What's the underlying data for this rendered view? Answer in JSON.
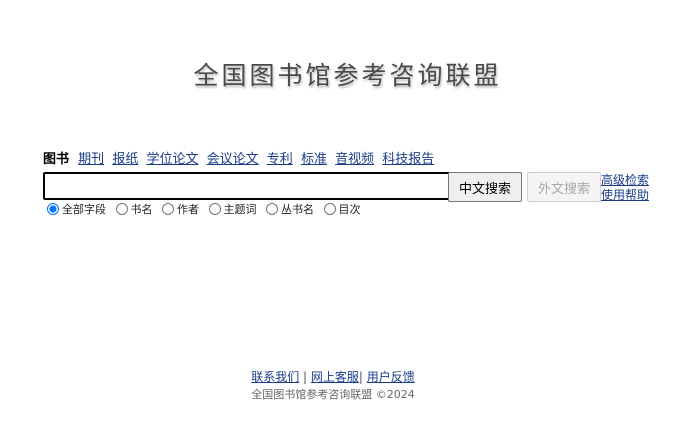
{
  "site_title": "全国图书馆参考咨询联盟",
  "tabs": [
    {
      "label": "图书",
      "active": true
    },
    {
      "label": "期刊"
    },
    {
      "label": "报纸"
    },
    {
      "label": "学位论文"
    },
    {
      "label": "会议论文"
    },
    {
      "label": "专利"
    },
    {
      "label": "标准"
    },
    {
      "label": "音视频"
    },
    {
      "label": "科技报告"
    }
  ],
  "search": {
    "value": "",
    "chinese_button": "中文搜索",
    "foreign_button": "外文搜索"
  },
  "side_links": {
    "advanced": "高级检索",
    "help": "使用帮助"
  },
  "fields": [
    {
      "label": "全部字段",
      "selected": true
    },
    {
      "label": "书名"
    },
    {
      "label": "作者"
    },
    {
      "label": "主题词"
    },
    {
      "label": "丛书名"
    },
    {
      "label": "目次"
    }
  ],
  "footer": {
    "contact": "联系我们",
    "sep1": " | ",
    "online_service": "网上客服",
    "sep2": "| ",
    "feedback": "用户反馈",
    "copyright": "全国图书馆参考咨询联盟 ©2024"
  }
}
